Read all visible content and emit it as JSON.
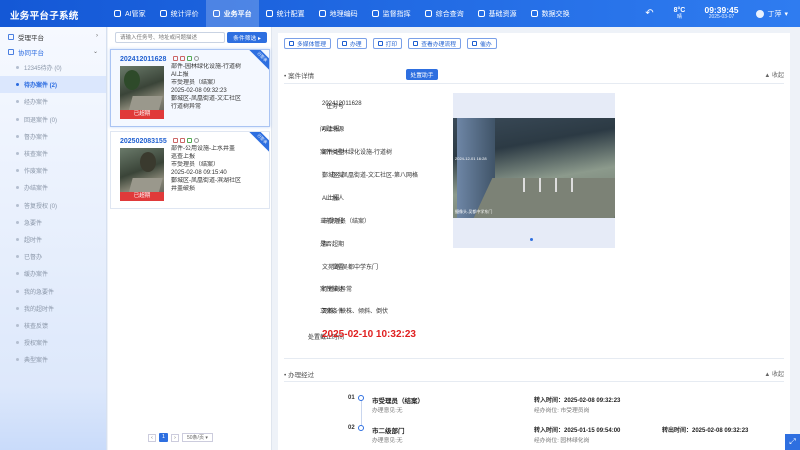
{
  "app": {
    "title": "业务平台子系统"
  },
  "nav": [
    {
      "label": "AI管家",
      "icon": "bulb-icon"
    },
    {
      "label": "统计评价",
      "icon": "chart-icon"
    },
    {
      "label": "业务平台",
      "icon": "grid-icon",
      "active": true
    },
    {
      "label": "统计配置",
      "icon": "settings-icon"
    },
    {
      "label": "地理编码",
      "icon": "map-icon"
    },
    {
      "label": "监督指挥",
      "icon": "monitor-icon"
    },
    {
      "label": "综合查询",
      "icon": "search-icon"
    },
    {
      "label": "基础资源",
      "icon": "database-icon"
    },
    {
      "label": "数据交换",
      "icon": "exchange-icon"
    }
  ],
  "header": {
    "weather": {
      "temp": "8°C",
      "desc": "晴"
    },
    "time": "09:39:45",
    "date": "2025-03-07",
    "user": "丁萍"
  },
  "sidebar": {
    "groups": [
      {
        "label": "受理平台",
        "open": false
      },
      {
        "label": "协同平台",
        "open": true
      }
    ],
    "items": [
      {
        "label": "12345待办 (0)"
      },
      {
        "label": "待办案件 (2)",
        "active": true
      },
      {
        "label": "经办案件"
      },
      {
        "label": "回退案件 (0)"
      },
      {
        "label": "督办案件"
      },
      {
        "label": "核查案件"
      },
      {
        "label": "作废案件"
      },
      {
        "label": "办结案件"
      },
      {
        "label": "答复授权 (0)"
      },
      {
        "label": "急要件"
      },
      {
        "label": "超时件"
      },
      {
        "label": "已督办"
      },
      {
        "label": "缓办案件"
      },
      {
        "label": "我的急要件"
      },
      {
        "label": "我的超时件"
      },
      {
        "label": "核查反馈"
      },
      {
        "label": "授权案件"
      },
      {
        "label": "典型案件"
      }
    ]
  },
  "list": {
    "search_placeholder": "请输入任务号、地址或问题描述",
    "filter_label": "条件筛选 ▸",
    "cards": [
      {
        "id": "202412011628",
        "corner": "已签收",
        "badge": "已超期",
        "lines": [
          "部件-园林绿化设施-行道树",
          "AI上报",
          "市受理员（结案）",
          "2025-02-08 09:32:23",
          "鄞城区-凤凰街道-文汇社区",
          "行道树异常"
        ]
      },
      {
        "id": "202502083155",
        "corner": "已签收",
        "badge": "已超期",
        "lines": [
          "部件-公用设施-上水井盖",
          "巡查上报",
          "市受理员（结案）",
          "2025-02-08 09:15:40",
          "鄞城区-凤凰街道-滨湖社区",
          "井盖破损"
        ]
      }
    ],
    "pager": {
      "prev": "‹",
      "current": "1",
      "next": "›",
      "page_size": "50条/页"
    }
  },
  "toolbar": {
    "buttons": [
      {
        "label": "多媒体管理",
        "name": "media-manage-button"
      },
      {
        "label": "办理",
        "name": "handle-button"
      },
      {
        "label": "打印",
        "name": "print-button"
      },
      {
        "label": "查看办理流程",
        "name": "view-flow-button"
      },
      {
        "label": "催办",
        "name": "urge-button"
      }
    ]
  },
  "detail": {
    "section_title": "• 案件详情",
    "collapse": "▲ 收起",
    "assist": "处置助手",
    "fields": [
      {
        "label": "任务号",
        "value": "202412011628"
      },
      {
        "label": "问题来源",
        "value": "AI上报"
      },
      {
        "label": "案件类型",
        "value": "部件-园林绿化设施-行道树"
      },
      {
        "label": "区域",
        "value": "鄞城区-凤凰街道-文汇社区-第八网格"
      },
      {
        "label": "上报人",
        "value": "AI上报"
      },
      {
        "label": "当前阶段",
        "value": "市受理员（结案）"
      },
      {
        "label": "是否超期",
        "value": "否"
      },
      {
        "label": "位置",
        "value": "文苑路-吴都中学东门"
      },
      {
        "label": "案件描述",
        "value": "行道树异常"
      },
      {
        "label": "立案条件",
        "value": "死株、缺株、倾斜、倒伏"
      }
    ],
    "deadline_label": "处置截止时间",
    "deadline": "2025-02-10 10:32:23",
    "photo": {
      "timestamp": "2024-12-01 16:28",
      "caption": "摄像头-吴都中学东门"
    }
  },
  "process": {
    "section_title": "• 办理经过",
    "collapse": "▲ 收起",
    "steps": [
      {
        "num": "01",
        "title": "市受理员（结案）",
        "opinion": "办理意见:无",
        "in_time": "转入时间：2025-02-08 09:32:23",
        "post": "经办岗位: 市受理员岗",
        "out_time": ""
      },
      {
        "num": "02",
        "title": "市二级部门",
        "opinion": "办理意见:无",
        "in_time": "转入时间：2025-01-15 09:54:00",
        "post": "经办岗位: 园林绿化岗",
        "out_time": "转出时间：2025-02-08 09:32:23"
      }
    ]
  },
  "colors": {
    "primary": "#2e6fe0",
    "danger": "#e03a3a"
  }
}
